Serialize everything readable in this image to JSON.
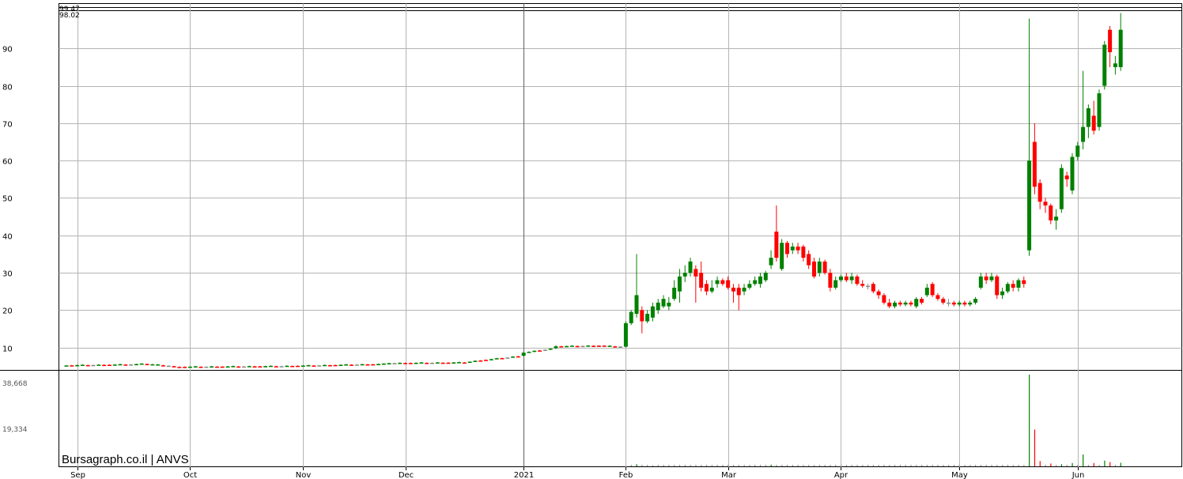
{
  "chart_data": {
    "type": "candlestick",
    "watermark": "Bursagraph.co.il | ANVS",
    "price_axis": {
      "ticks": [
        10,
        20,
        30,
        40,
        50,
        60,
        70,
        80,
        90
      ],
      "ylim": [
        4,
        100
      ]
    },
    "header_values": [
      "99.47",
      "98.02"
    ],
    "volume_axis": {
      "ticks": [
        "38,668",
        "19,334"
      ],
      "values": [
        38668,
        19334
      ],
      "ylim": [
        0,
        40000
      ]
    },
    "x_ticks": [
      "Sep",
      "Oct",
      "Nov",
      "Dec",
      "2021",
      "Feb",
      "Mar",
      "Apr",
      "May",
      "Jun"
    ],
    "x_tick_index": [
      2,
      23,
      44,
      63,
      85,
      104,
      123,
      144,
      166,
      188
    ],
    "n_bars": 198,
    "candles": [
      [
        0,
        5.0,
        5.2,
        5.25,
        4.95
      ],
      [
        14,
        5.5,
        5.7,
        5.8,
        5.4
      ],
      [
        20,
        5.0,
        4.8,
        5.1,
        4.7
      ],
      [
        40,
        5.0,
        5.0,
        5.1,
        4.9
      ],
      [
        60,
        5.6,
        5.8,
        5.9,
        5.5
      ],
      [
        75,
        6.0,
        6.2,
        6.3,
        5.9
      ],
      [
        85,
        7.8,
        8.6,
        8.8,
        7.6
      ],
      [
        91,
        9.8,
        10.3,
        10.6,
        9.6
      ],
      [
        100,
        10.5,
        10.4,
        10.6,
        10.2
      ],
      [
        104,
        10.2,
        16.5,
        17.0,
        10.0
      ],
      [
        105,
        16.5,
        19.5,
        20.0,
        16.0
      ],
      [
        106,
        19.0,
        24.0,
        35.0,
        18.0
      ],
      [
        107,
        20.0,
        17.0,
        21.0,
        13.8
      ],
      [
        108,
        17.0,
        19.0,
        20.0,
        16.5
      ],
      [
        109,
        18.0,
        21.0,
        22.0,
        17.0
      ],
      [
        110,
        20.0,
        22.0,
        23.0,
        19.0
      ],
      [
        111,
        21.0,
        23.0,
        24.0,
        20.5
      ],
      [
        112,
        21.0,
        22.0,
        23.5,
        20.0
      ],
      [
        113,
        23.0,
        26.0,
        28.0,
        22.5
      ],
      [
        114,
        25.0,
        29.0,
        31.0,
        22.0
      ],
      [
        115,
        29.0,
        30.0,
        32.0,
        27.5
      ],
      [
        116,
        30.0,
        33.0,
        34.0,
        29.0
      ],
      [
        117,
        31.0,
        29.0,
        32.0,
        22.0
      ],
      [
        118,
        30.0,
        26.0,
        33.0,
        25.0
      ],
      [
        119,
        27.0,
        25.0,
        28.0,
        24.0
      ],
      [
        120,
        25.0,
        26.0,
        28.0,
        24.5
      ],
      [
        121,
        27.0,
        28.0,
        29.0,
        26.0
      ],
      [
        122,
        28.0,
        27.0,
        28.5,
        26.5
      ],
      [
        123,
        28.0,
        26.0,
        29.0,
        25.5
      ],
      [
        124,
        26.0,
        25.0,
        27.0,
        22.0
      ],
      [
        125,
        26.0,
        24.0,
        27.0,
        20.0
      ],
      [
        126,
        25.0,
        26.0,
        27.0,
        24.0
      ],
      [
        127,
        26.0,
        27.0,
        28.0,
        25.5
      ],
      [
        128,
        27.0,
        28.0,
        29.0,
        26.5
      ],
      [
        129,
        27.0,
        29.0,
        30.0,
        26.0
      ],
      [
        130,
        28.0,
        30.0,
        30.5,
        27.5
      ],
      [
        131,
        32.0,
        34.0,
        36.0,
        31.0
      ],
      [
        132,
        41.0,
        34.0,
        48.0,
        33.0
      ],
      [
        133,
        31.0,
        38.0,
        39.0,
        30.5
      ],
      [
        134,
        38.0,
        35.0,
        38.5,
        34.0
      ],
      [
        135,
        36.0,
        37.0,
        38.0,
        35.0
      ],
      [
        136,
        37.0,
        36.0,
        38.0,
        35.0
      ],
      [
        137,
        37.0,
        34.0,
        37.5,
        33.0
      ],
      [
        138,
        35.0,
        32.0,
        36.0,
        31.0
      ],
      [
        139,
        33.0,
        29.0,
        34.0,
        28.5
      ],
      [
        140,
        30.0,
        33.0,
        34.0,
        29.0
      ],
      [
        141,
        33.0,
        30.0,
        33.5,
        29.5
      ],
      [
        142,
        30.0,
        26.0,
        31.0,
        25.0
      ],
      [
        143,
        26.0,
        28.0,
        29.0,
        25.5
      ],
      [
        144,
        28.0,
        29.0,
        29.5,
        27.5
      ],
      [
        145,
        29.0,
        28.0,
        30.0,
        27.5
      ],
      [
        146,
        28.0,
        29.0,
        30.0,
        27.0
      ],
      [
        147,
        29.0,
        27.0,
        29.5,
        26.5
      ],
      [
        148,
        27.0,
        26.5,
        28.0,
        26.0
      ],
      [
        149,
        26.5,
        26.5,
        27.0,
        25.5
      ],
      [
        150,
        27.0,
        25.0,
        27.5,
        24.5
      ],
      [
        151,
        25.0,
        24.0,
        25.5,
        23.0
      ],
      [
        152,
        24.0,
        22.0,
        24.5,
        21.5
      ],
      [
        153,
        22.0,
        21.0,
        23.0,
        20.5
      ],
      [
        154,
        21.0,
        22.0,
        22.5,
        20.5
      ],
      [
        155,
        22.0,
        21.5,
        22.5,
        21.0
      ],
      [
        156,
        21.5,
        22.0,
        22.5,
        21.0
      ],
      [
        157,
        22.0,
        21.5,
        22.5,
        21.0
      ],
      [
        158,
        21.0,
        23.0,
        23.5,
        20.5
      ],
      [
        159,
        23.0,
        22.0,
        23.5,
        21.5
      ],
      [
        160,
        24.0,
        26.0,
        27.0,
        23.5
      ],
      [
        161,
        27.0,
        24.0,
        27.5,
        23.5
      ],
      [
        162,
        24.0,
        23.0,
        24.5,
        22.5
      ],
      [
        163,
        23.0,
        22.0,
        23.5,
        21.5
      ],
      [
        164,
        22.0,
        22.0,
        23.0,
        21.0
      ],
      [
        165,
        22.0,
        21.5,
        22.5,
        21.0
      ],
      [
        166,
        21.5,
        22.0,
        22.5,
        21.0
      ],
      [
        167,
        22.0,
        21.5,
        22.5,
        21.0
      ],
      [
        168,
        21.5,
        22.0,
        22.5,
        21.0
      ],
      [
        169,
        22.0,
        23.0,
        23.5,
        21.5
      ],
      [
        170,
        26.0,
        29.0,
        30.0,
        25.5
      ],
      [
        171,
        29.0,
        28.0,
        30.0,
        27.0
      ],
      [
        172,
        28.0,
        29.0,
        30.0,
        27.5
      ],
      [
        173,
        29.0,
        24.0,
        29.5,
        23.0
      ],
      [
        174,
        24.0,
        25.0,
        26.0,
        23.0
      ],
      [
        175,
        25.0,
        27.0,
        27.5,
        24.5
      ],
      [
        176,
        27.0,
        26.0,
        28.0,
        25.0
      ],
      [
        177,
        26.0,
        28.0,
        28.5,
        25.0
      ],
      [
        178,
        28.0,
        27.0,
        29.0,
        26.0
      ],
      [
        179,
        36.0,
        60.0,
        98.0,
        34.5
      ],
      [
        180,
        65.0,
        53.0,
        70.0,
        51.0
      ],
      [
        181,
        54.0,
        49.0,
        55.0,
        47.0
      ],
      [
        182,
        49.0,
        48.0,
        50.0,
        46.0
      ],
      [
        183,
        48.0,
        44.0,
        48.5,
        43.0
      ],
      [
        184,
        44.0,
        45.0,
        47.0,
        41.5
      ],
      [
        185,
        47.0,
        58.0,
        59.0,
        46.0
      ],
      [
        186,
        56.0,
        55.0,
        57.0,
        53.0
      ],
      [
        187,
        52.0,
        61.0,
        62.0,
        51.0
      ],
      [
        188,
        61.0,
        64.0,
        65.0,
        60.0
      ],
      [
        189,
        65.0,
        69.0,
        84.0,
        63.0
      ],
      [
        190,
        69.0,
        74.0,
        75.0,
        66.0
      ],
      [
        191,
        72.0,
        68.0,
        76.0,
        67.0
      ],
      [
        192,
        69.0,
        78.0,
        79.0,
        68.0
      ],
      [
        193,
        80.0,
        91.0,
        92.0,
        79.0
      ],
      [
        194,
        95.0,
        89.0,
        96.0,
        85.0
      ],
      [
        195,
        85.0,
        86.0,
        88.0,
        83.0
      ],
      [
        196,
        85.0,
        95.0,
        99.47,
        84.0
      ]
    ],
    "volume": [
      [
        106,
        900
      ],
      [
        109,
        300
      ],
      [
        131,
        700
      ],
      [
        179,
        38668
      ],
      [
        180,
        15500
      ],
      [
        181,
        2200
      ],
      [
        183,
        1200
      ],
      [
        185,
        900
      ],
      [
        187,
        1400
      ],
      [
        189,
        5000
      ],
      [
        191,
        1400
      ],
      [
        193,
        2400
      ],
      [
        194,
        1800
      ],
      [
        196,
        1500
      ]
    ],
    "colors": {
      "up": "#008000",
      "down": "#ff0000",
      "grid": "#b4b4b4",
      "axis": "#000000",
      "flat": "#8a8a8a",
      "volume_label": "#555555"
    }
  }
}
